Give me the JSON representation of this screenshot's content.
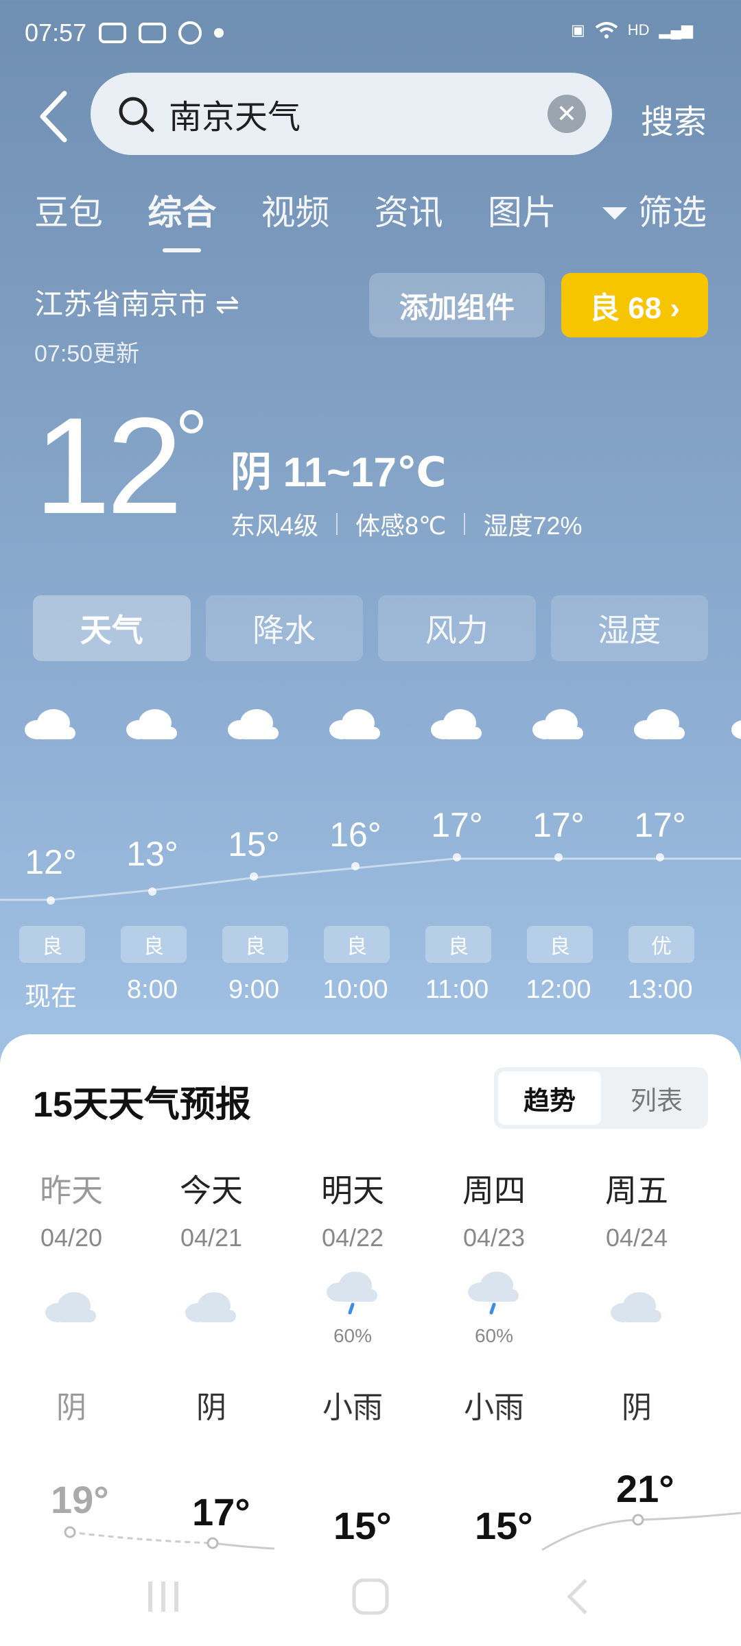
{
  "status": {
    "time": "07:57",
    "hd": "HD"
  },
  "search": {
    "query": "南京天气",
    "button": "搜索"
  },
  "tabs": [
    "豆包",
    "综合",
    "视频",
    "资讯",
    "图片",
    "筛选"
  ],
  "location": {
    "city": "江苏省南京市",
    "updated": "07:50更新",
    "add_widget": "添加组件",
    "aqi": "良 68 ›"
  },
  "current": {
    "temp": "12",
    "condition": "阴  11~17℃",
    "wind": "东风4级",
    "feels": "体感8℃",
    "humidity": "湿度72%"
  },
  "chips": [
    "天气",
    "降水",
    "风力",
    "湿度"
  ],
  "hourly": [
    {
      "temp": "12°",
      "aq": "良",
      "time": "现在"
    },
    {
      "temp": "13°",
      "aq": "良",
      "time": "8:00"
    },
    {
      "temp": "15°",
      "aq": "良",
      "time": "9:00"
    },
    {
      "temp": "16°",
      "aq": "良",
      "time": "10:00"
    },
    {
      "temp": "17°",
      "aq": "良",
      "time": "11:00"
    },
    {
      "temp": "17°",
      "aq": "良",
      "time": "12:00"
    },
    {
      "temp": "17°",
      "aq": "优",
      "time": "13:00"
    }
  ],
  "forecast": {
    "title": "15天天气预报",
    "seg": [
      "趋势",
      "列表"
    ],
    "days": [
      {
        "name": "昨天",
        "date": "04/20",
        "wx": "阴",
        "pp": "",
        "high": "19°"
      },
      {
        "name": "今天",
        "date": "04/21",
        "wx": "阴",
        "pp": "",
        "high": "17°"
      },
      {
        "name": "明天",
        "date": "04/22",
        "wx": "小雨",
        "pp": "60%",
        "high": "15°"
      },
      {
        "name": "周四",
        "date": "04/23",
        "wx": "小雨",
        "pp": "60%",
        "high": "15°"
      },
      {
        "name": "周五",
        "date": "04/24",
        "wx": "阴",
        "pp": "",
        "high": "21°"
      }
    ]
  }
}
